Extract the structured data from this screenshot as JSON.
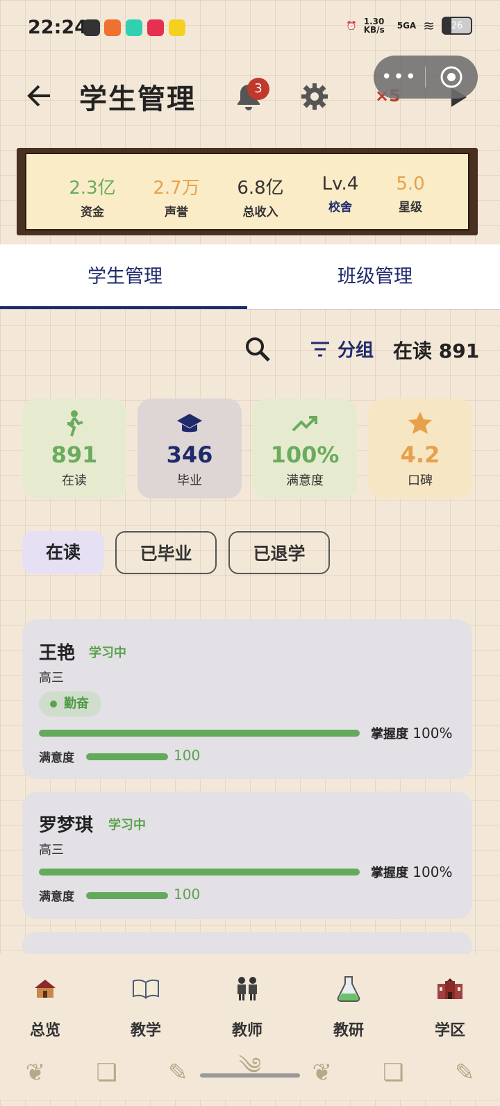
{
  "status_bar": {
    "time": "22:24",
    "net_speed": "1.30 KB/s",
    "signal": "5GA",
    "battery": "26"
  },
  "header": {
    "title": "学生管理",
    "notification_count": "3",
    "speed_label": "×5"
  },
  "stats": [
    {
      "value": "2.3亿",
      "label": "资金",
      "color": "#6aab5d"
    },
    {
      "value": "2.7万",
      "label": "声誉",
      "color": "#e8a04a"
    },
    {
      "value": "6.8亿",
      "label": "总收入",
      "color": "#333333"
    },
    {
      "value": "Lv.4",
      "label": "校舍",
      "color": "#333333"
    },
    {
      "value": "5.0",
      "label": "星级",
      "color": "#e8a04a"
    }
  ],
  "tabs": [
    "学生管理",
    "班级管理"
  ],
  "toolbar": {
    "group_label": "分组",
    "reading_count": "在读 891"
  },
  "summary": [
    {
      "value": "891",
      "label": "在读",
      "icon": "person-walking-icon",
      "color": "#6aab5d",
      "bg": "#e6ebcf"
    },
    {
      "value": "346",
      "label": "毕业",
      "icon": "graduation-cap-icon",
      "color": "#1f2a6b",
      "bg": "#ddd6d4"
    },
    {
      "value": "100%",
      "label": "满意度",
      "icon": "trending-up-icon",
      "color": "#6aab5d",
      "bg": "#e6ebcf"
    },
    {
      "value": "4.2",
      "label": "口碑",
      "icon": "star-icon",
      "color": "#e8a04a",
      "bg": "#f7e6c4"
    }
  ],
  "filters": [
    "在读",
    "已毕业",
    "已退学"
  ],
  "students": [
    {
      "name": "王艳",
      "status": "学习中",
      "grade": "高三",
      "trait": "勤奋",
      "mastery_label": "掌握度",
      "mastery": "100%",
      "mastery_value": 1.0,
      "satisfaction_label": "满意度",
      "satisfaction": "100",
      "satisfaction_value": 1.0
    },
    {
      "name": "罗梦琪",
      "status": "学习中",
      "grade": "高三",
      "mastery_label": "掌握度",
      "mastery": "100%",
      "mastery_value": 1.0,
      "satisfaction_label": "满意度",
      "satisfaction": "100",
      "satisfaction_value": 1.0
    }
  ],
  "nav": [
    {
      "label": "总览",
      "icon": "school-house-icon"
    },
    {
      "label": "教学",
      "icon": "open-book-icon"
    },
    {
      "label": "教师",
      "icon": "teachers-icon"
    },
    {
      "label": "教研",
      "icon": "flask-icon"
    },
    {
      "label": "学区",
      "icon": "campus-building-icon"
    }
  ]
}
